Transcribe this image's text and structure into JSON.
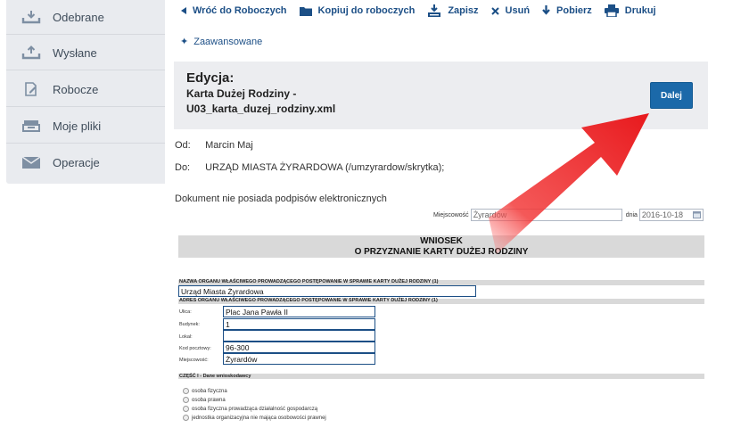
{
  "sidebar": {
    "items": [
      {
        "label": "Odebrane",
        "icon": "inbox-download-icon"
      },
      {
        "label": "Wysłane",
        "icon": "outbox-upload-icon"
      },
      {
        "label": "Robocze",
        "icon": "draft-edit-icon"
      },
      {
        "label": "Moje pliki",
        "icon": "files-stack-icon"
      },
      {
        "label": "Operacje",
        "icon": "envelope-icon"
      }
    ]
  },
  "toolbar": {
    "back": "Wróć do Roboczych",
    "copy": "Kopiuj do roboczych",
    "save": "Zapisz",
    "delete": "Usuń",
    "download": "Pobierz",
    "print": "Drukuj"
  },
  "advanced": "Zaawansowane",
  "edit": {
    "title": "Edycja:",
    "doc_line1": "Karta Dużej Rodziny -",
    "doc_line2": "U03_karta_duzej_rodziny.xml",
    "next": "Dalej"
  },
  "meta": {
    "from_label": "Od:",
    "from_value": "Marcin Maj",
    "to_label": "Do:",
    "to_value": "URZĄD MIASTA ŻYRARDOWA (/umzyrardow/skrytka);"
  },
  "no_signatures": "Dokument nie posiada podpisów elektronicznych",
  "place": {
    "label": "Miejscowość",
    "value": "Żyrardów",
    "date_label": "dnia",
    "date_value": "2016-10-18"
  },
  "form": {
    "header_line1": "WNIOSEK",
    "header_line2": "O PRZYZNANIE KARTY DUŻEJ RODZINY",
    "authority_name_label": "NAZWA ORGANU WŁAŚCIWEGO PROWADZĄCEGO POSTĘPOWANIE W SPRAWIE KARTY DUŻEJ RODZINY (1)",
    "authority_name_value": "Urząd Miasta Żyrardowa",
    "authority_address_label": "ADRES ORGANU WŁAŚCIWEGO PROWADZĄCEGO POSTĘPOWANIE W SPRAWIE KARTY DUŻEJ RODZINY (1)",
    "fields": [
      {
        "label": "Ulica:",
        "value": "Plac Jana Pawła II"
      },
      {
        "label": "Budynek:",
        "value": "1"
      },
      {
        "label": "Lokal:",
        "value": ""
      },
      {
        "label": "Kod pocztowy:",
        "value": "96-300"
      },
      {
        "label": "Miejscowość:",
        "value": "Żyrardów"
      }
    ],
    "part1_label": "CZĘŚĆ I - Dane wnioskodawcy",
    "applicant_types": [
      "osoba fizyczna",
      "osoba prawna",
      "osoba fizyczna prowadząca działalność gospodarczą",
      "jednostka organizacyjna nie mająca osobowości prawnej"
    ]
  },
  "colors": {
    "link": "#1c4f86",
    "button": "#1b69a9",
    "sidebar_bg": "#e9ebef",
    "annotation_arrow": "#e8191d"
  }
}
